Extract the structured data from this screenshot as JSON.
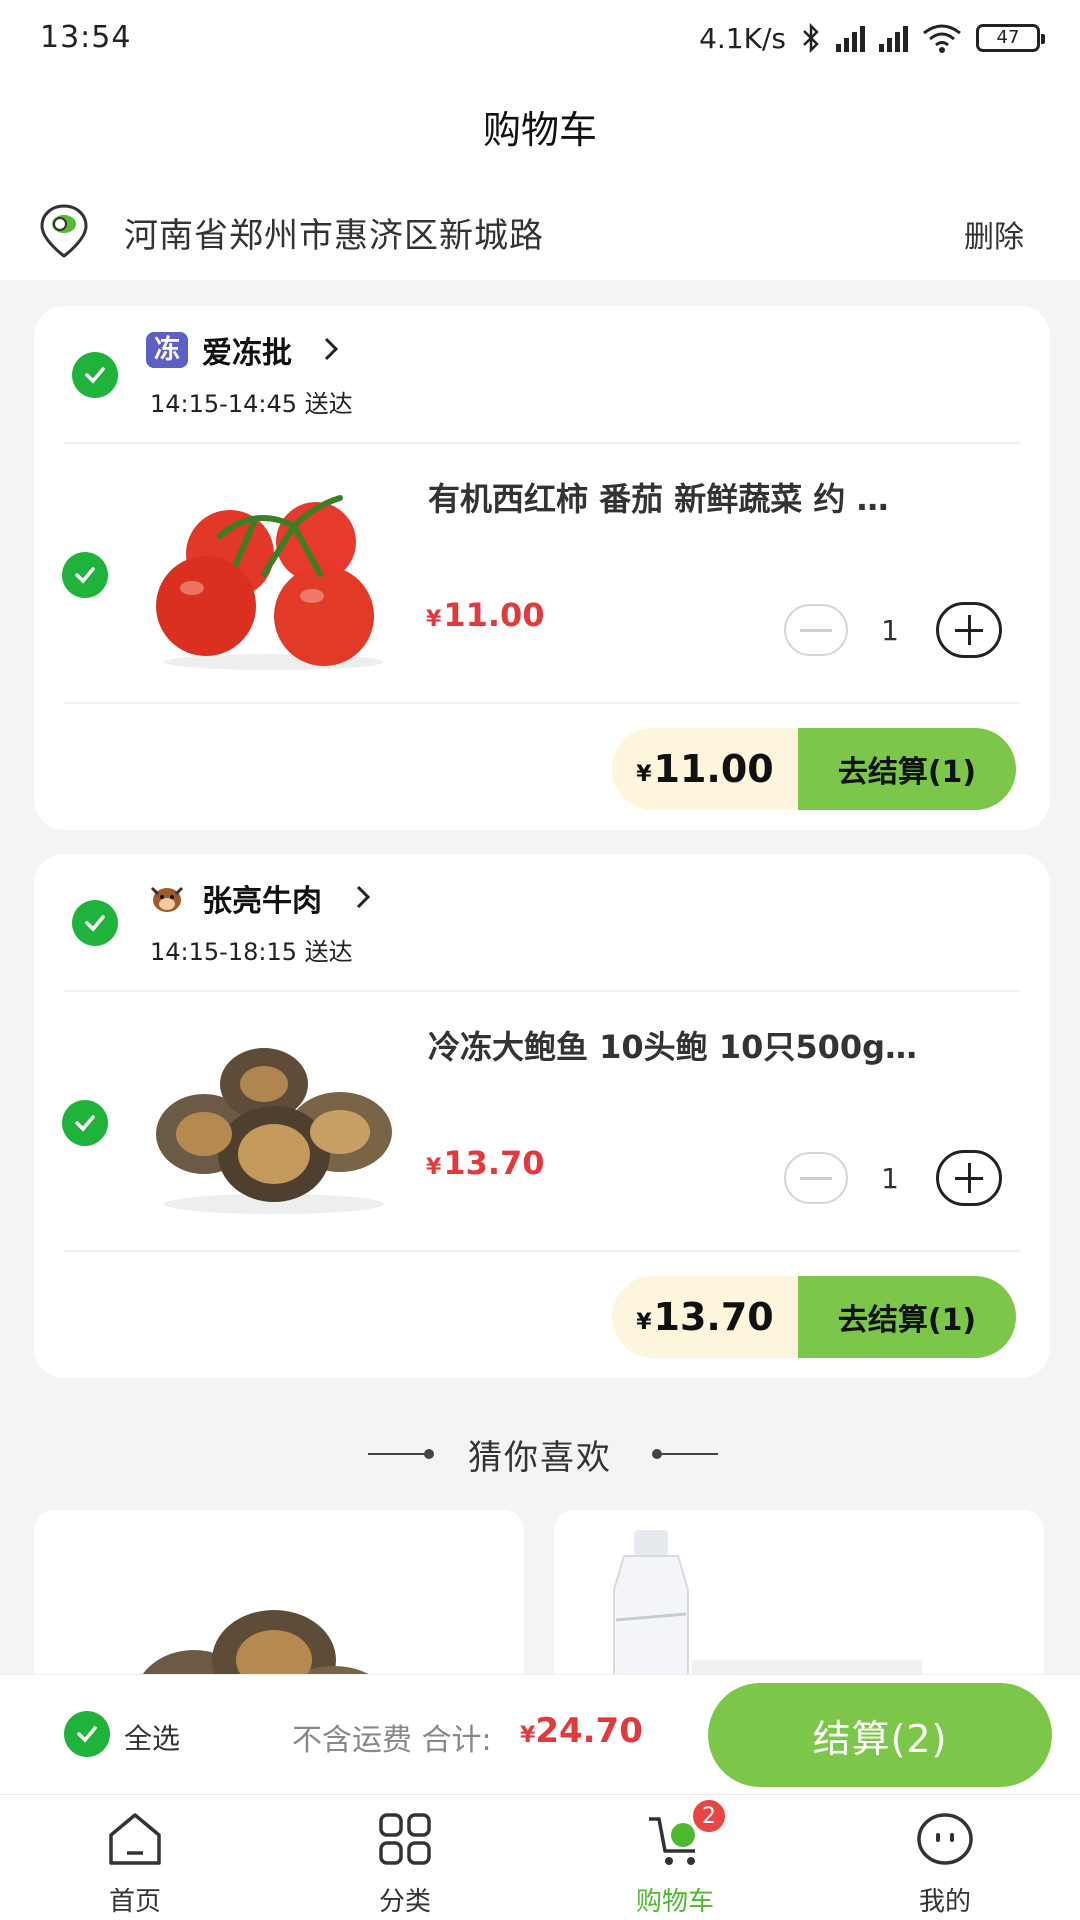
{
  "status_bar": {
    "time": "13:54",
    "speed": "4.1K/s",
    "battery": "47"
  },
  "header": {
    "title": "购物车"
  },
  "address": {
    "text": "河南省郑州市惠济区新城路",
    "delete_label": "删除"
  },
  "stores": [
    {
      "name": "爱冻批",
      "logo_text": "冻",
      "delivery_time": "14:15-14:45 送达",
      "product": {
        "name": "有机西红柿 番茄 新鲜蔬菜 约 …",
        "currency": "¥",
        "price": "11.00",
        "quantity": "1",
        "image": "tomato"
      },
      "subtotal_currency": "¥",
      "subtotal": "11.00",
      "checkout_label": "去结算(1)"
    },
    {
      "name": "张亮牛肉",
      "delivery_time": "14:15-18:15 送达",
      "product": {
        "name": "冷冻大鲍鱼 10头鲍 10只500g…",
        "currency": "¥",
        "price": "13.70",
        "quantity": "1",
        "image": "abalone"
      },
      "subtotal_currency": "¥",
      "subtotal": "13.70",
      "checkout_label": "去结算(1)"
    }
  ],
  "recommend": {
    "title": "猜你喜欢",
    "items": [
      {
        "image": "abalone"
      },
      {
        "image": "water-bottle"
      }
    ]
  },
  "checkout_bar": {
    "select_all_label": "全选",
    "shipping_note": "不含运费 合计:",
    "currency": "¥",
    "total": "24.70",
    "button_label": "结算(2)"
  },
  "tabs": [
    {
      "label": "首页",
      "icon": "home-icon"
    },
    {
      "label": "分类",
      "icon": "grid-icon"
    },
    {
      "label": "购物车",
      "icon": "cart-icon",
      "active": true,
      "badge": "2"
    },
    {
      "label": "我的",
      "icon": "profile-icon"
    }
  ],
  "colors": {
    "accent_green": "#7cc749",
    "check_green": "#1fb33c",
    "price_red": "#e4393c",
    "footer_cream": "#fdf5dc",
    "badge_red": "#e94545"
  }
}
